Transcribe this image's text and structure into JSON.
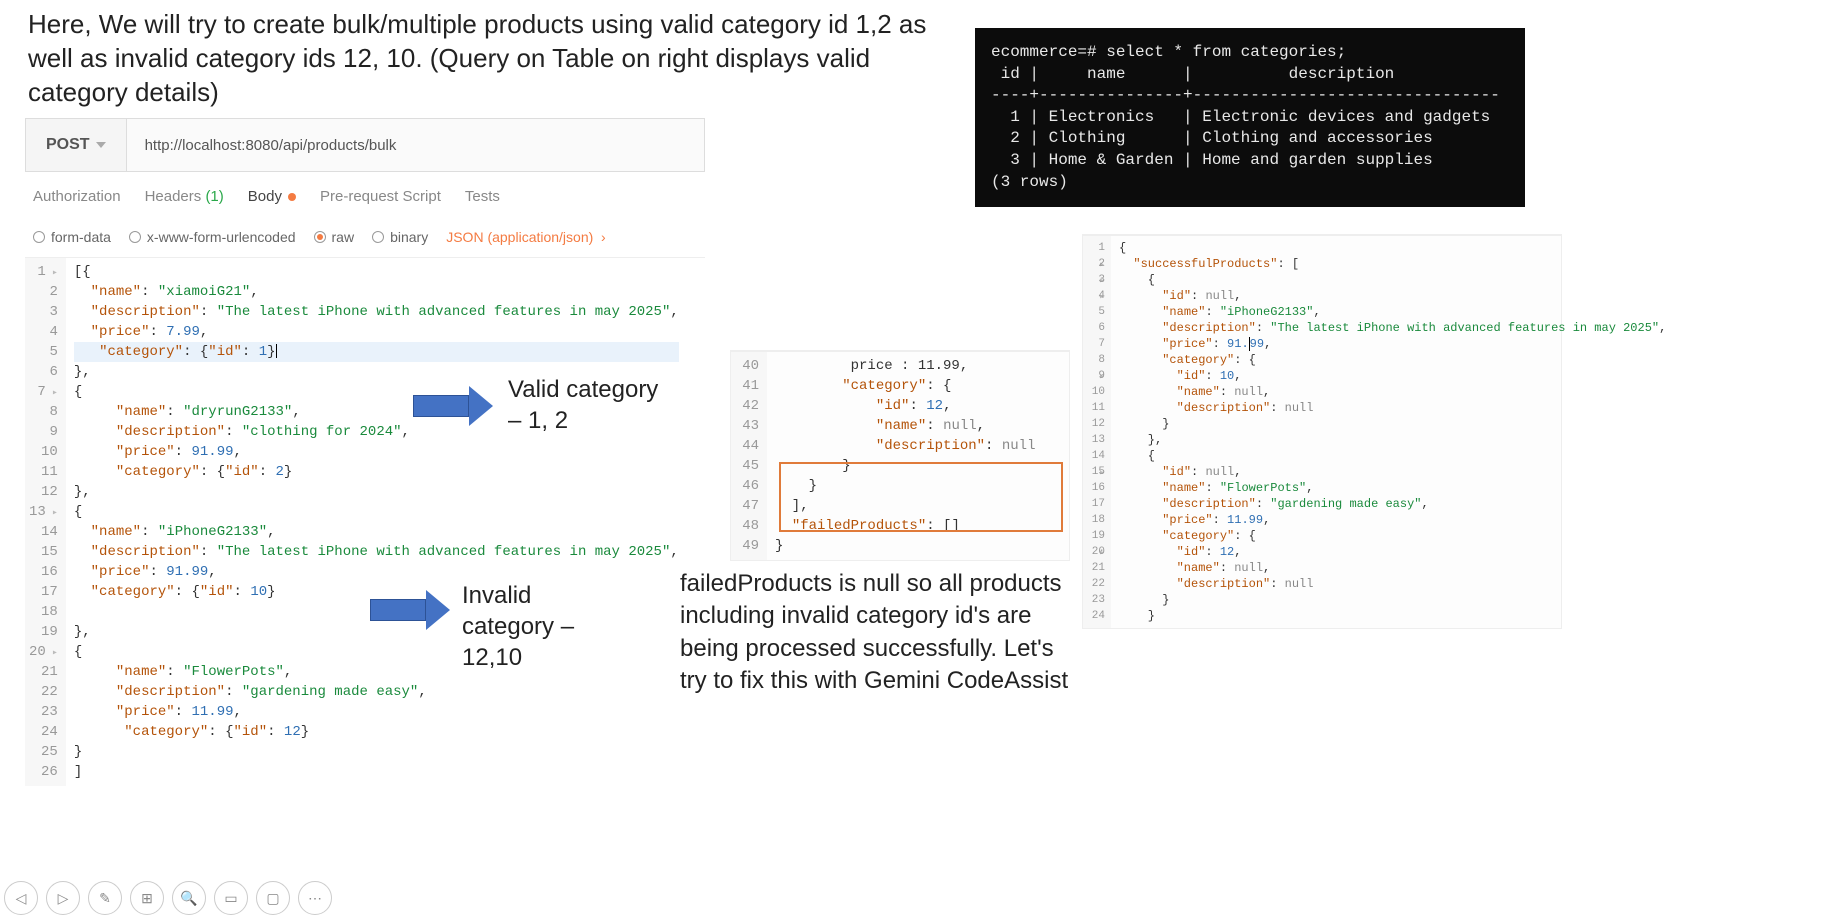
{
  "explain_top": "Here, We will try to create bulk/multiple products using valid category id 1,2 as well as invalid category ids 12, 10. (Query on Table on right displays valid category details)",
  "postman": {
    "method": "POST",
    "url": "http://localhost:8080/api/products/bulk",
    "tabs": {
      "authorization": "Authorization",
      "headers": "Headers",
      "headers_count": "(1)",
      "body": "Body",
      "prerequest": "Pre-request Script",
      "tests": "Tests"
    },
    "body_opts": {
      "formdata": "form-data",
      "urlencoded": "x-www-form-urlencoded",
      "raw": "raw",
      "binary": "binary",
      "json_type": "JSON (application/json)"
    },
    "body_json": [
      {
        "name": "xiamoiG21",
        "description": "The latest iPhone with advanced features in may 2025",
        "price": 7.99,
        "category": {
          "id": 1
        }
      },
      {
        "name": "dryrunG2133",
        "description": "clothing for 2024",
        "price": 91.99,
        "category": {
          "id": 2
        }
      },
      {
        "name": "iPhoneG2133",
        "description": "The latest iPhone with advanced features in may 2025",
        "price": 91.99,
        "category": {
          "id": 10
        }
      },
      {
        "name": "FlowerPots",
        "description": "gardening made easy",
        "price": 11.99,
        "category": {
          "id": 12
        }
      }
    ]
  },
  "annot": {
    "valid": "Valid category – 1, 2",
    "invalid": "Invalid category – 12,10"
  },
  "terminal": {
    "prompt": "ecommerce=# select * from categories;",
    "headers": [
      "id",
      "name",
      "description"
    ],
    "rows": [
      {
        "id": "1",
        "name": "Electronics",
        "description": "Electronic devices and gadgets"
      },
      {
        "id": "2",
        "name": "Clothing",
        "description": "Clothing and accessories"
      },
      {
        "id": "3",
        "name": "Home & Garden",
        "description": "Home and garden supplies"
      }
    ],
    "footer": "(3 rows)"
  },
  "resp_failed": {
    "lines_start": 40,
    "content": {
      "price": 11.99,
      "category": {
        "id": 12,
        "name": null,
        "description": null
      },
      "failedProducts": []
    }
  },
  "resp_full": {
    "successfulProducts": [
      {
        "id": null,
        "name": "iPhoneG2133",
        "description": "The latest iPhone with advanced features in may 2025",
        "price": 91.99,
        "category": {
          "id": 10,
          "name": null,
          "description": null
        }
      },
      {
        "id": null,
        "name": "FlowerPots",
        "description": "gardening made easy",
        "price": 11.99,
        "category": {
          "id": 12,
          "name": null,
          "description": null
        }
      }
    ]
  },
  "explain_mid": "failedProducts is null so all products including invalid category id's are being processed successfully. Let's try to fix this with Gemini CodeAssist"
}
